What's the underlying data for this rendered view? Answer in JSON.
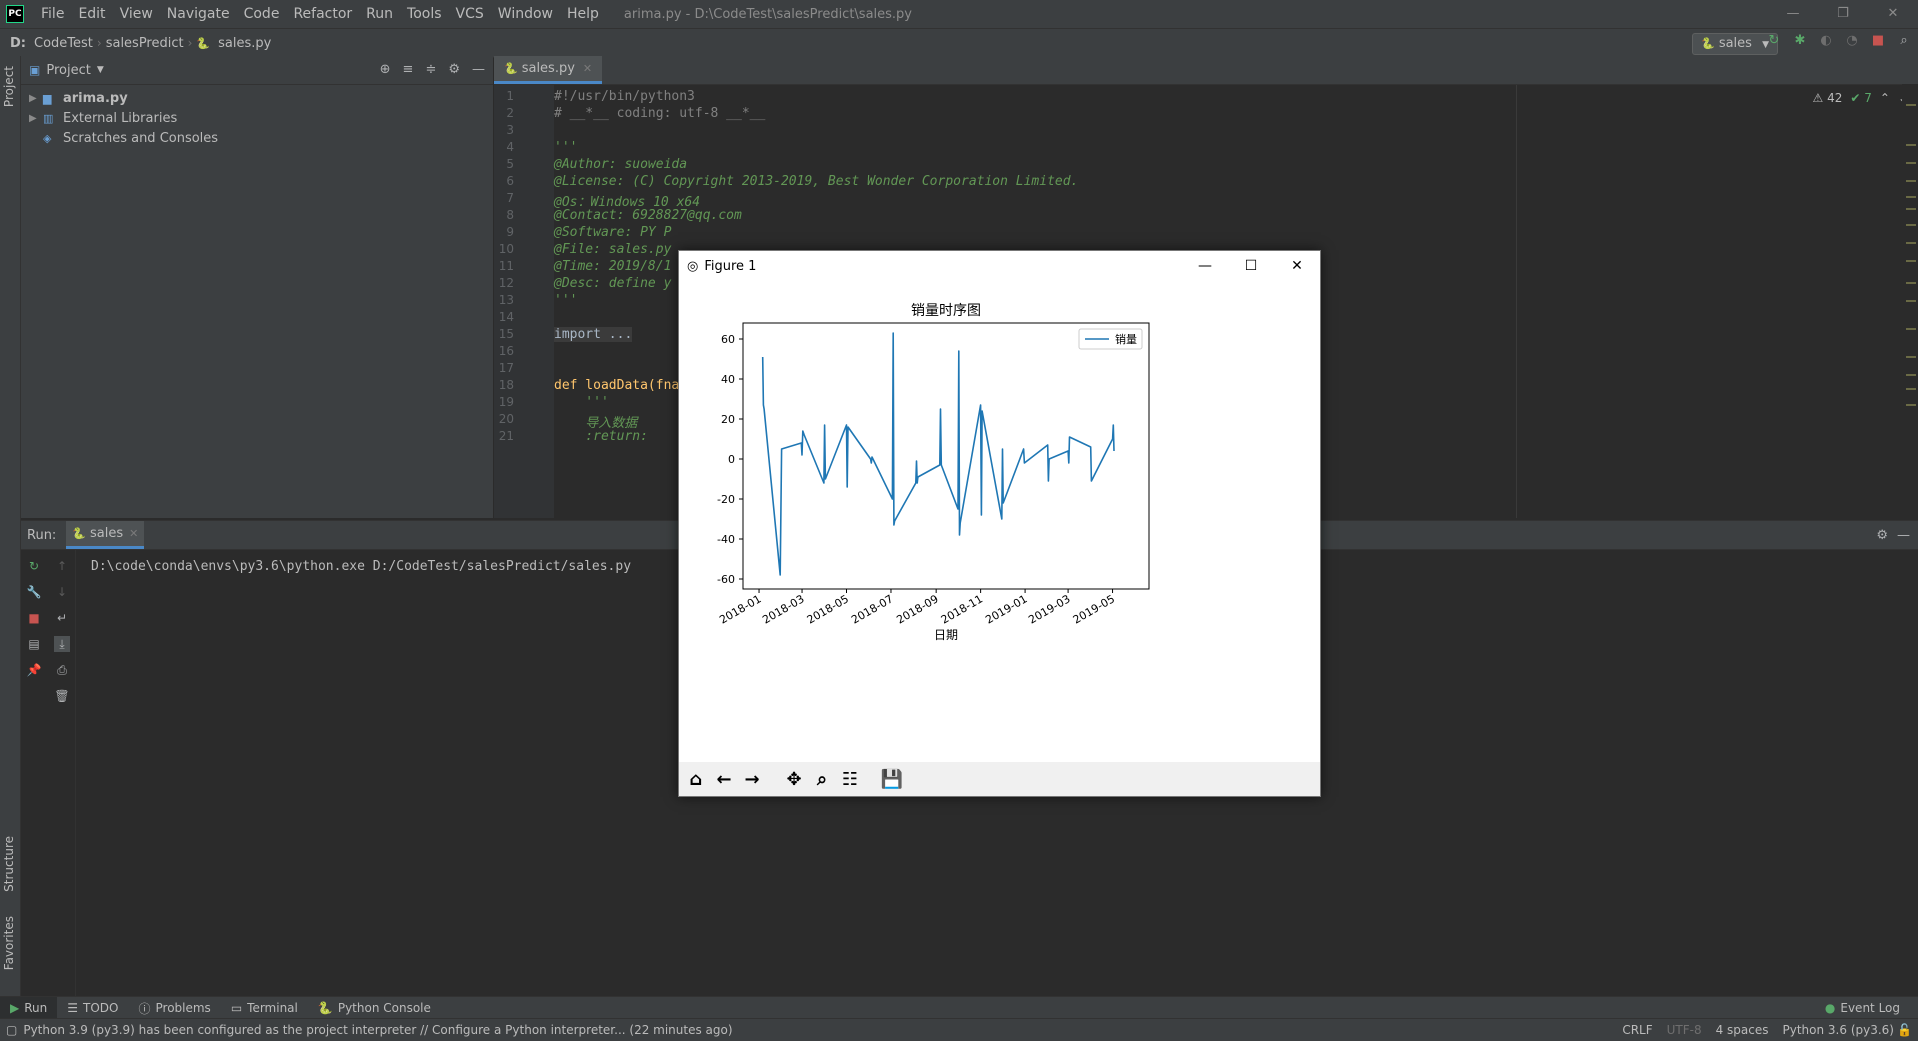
{
  "window": {
    "title": "arima.py - D:\\CodeTest\\salesPredict\\sales.py",
    "logo": "PC",
    "controls": [
      "—",
      "❐",
      "✕"
    ]
  },
  "menu": [
    "File",
    "Edit",
    "View",
    "Navigate",
    "Code",
    "Refactor",
    "Run",
    "Tools",
    "VCS",
    "Window",
    "Help"
  ],
  "breadcrumb": [
    "D:",
    "CodeTest",
    "salesPredict",
    "sales.py"
  ],
  "run_config": "sales",
  "project": {
    "header": "Project",
    "items": [
      {
        "label": "arima.py",
        "bold": true
      },
      {
        "label": "External Libraries",
        "bold": false
      },
      {
        "label": "Scratches and Consoles",
        "bold": false
      }
    ]
  },
  "side_tabs": {
    "project": "Project",
    "structure": "Structure",
    "favorites": "Favorites"
  },
  "editor": {
    "tab": "sales.py",
    "warnings": "⚠ 42",
    "checks": "✔ 7",
    "lines": [
      {
        "n": "1",
        "text": "#!/usr/bin/python3",
        "cls": "c-com"
      },
      {
        "n": "2",
        "text": "# __*__ coding: utf-8 __*__",
        "cls": "c-com"
      },
      {
        "n": "3",
        "text": "",
        "cls": ""
      },
      {
        "n": "4",
        "text": "'''",
        "cls": "c-doc"
      },
      {
        "n": "5",
        "text": "@Author: suoweida",
        "cls": "c-doc"
      },
      {
        "n": "6",
        "text": "@License: (C) Copyright 2013-2019, Best Wonder Corporation Limited.",
        "cls": "c-doc"
      },
      {
        "n": "7",
        "text": "@Os：Windows 10 x64",
        "cls": "c-doc"
      },
      {
        "n": "8",
        "text": "@Contact: 6928827@qq.com",
        "cls": "c-doc"
      },
      {
        "n": "9",
        "text": "@Software: PY P",
        "cls": "c-doc"
      },
      {
        "n": "10",
        "text": "@File: sales.py",
        "cls": "c-doc"
      },
      {
        "n": "11",
        "text": "@Time: 2019/8/1",
        "cls": "c-doc"
      },
      {
        "n": "12",
        "text": "@Desc: define y",
        "cls": "c-doc"
      },
      {
        "n": "13",
        "text": "'''",
        "cls": "c-doc"
      },
      {
        "n": "14",
        "text": "",
        "cls": ""
      },
      {
        "n": "15",
        "text": "import ...",
        "cls": "c-fold"
      },
      {
        "n": "16",
        "text": "",
        "cls": ""
      },
      {
        "n": "17",
        "text": "",
        "cls": ""
      },
      {
        "n": "18",
        "text": "def loadData(fna",
        "cls": "c-fn"
      },
      {
        "n": "19",
        "text": "    '''",
        "cls": "c-doc"
      },
      {
        "n": "20",
        "text": "    导入数据",
        "cls": "c-doc"
      },
      {
        "n": "21",
        "text": "    :return:",
        "cls": "c-doc"
      }
    ]
  },
  "run_panel": {
    "label": "Run:",
    "tab": "sales",
    "console": "D:\\code\\conda\\envs\\py3.6\\python.exe D:/CodeTest/salesPredict/sales.py"
  },
  "tool_windows": [
    "Run",
    "TODO",
    "Problems",
    "Terminal",
    "Python Console"
  ],
  "event_log": "Event Log",
  "status": {
    "message": "Python 3.9 (py3.9) has been configured as the project interpreter // Configure a Python interpreter... (22 minutes ago)",
    "line_sep": "CRLF",
    "encoding": "UTF-8",
    "indent": "4 spaces",
    "interpreter": "Python 3.6 (py3.6)"
  },
  "figure": {
    "title": "Figure 1",
    "controls": [
      "—",
      "☐",
      "✕"
    ]
  },
  "chart_data": {
    "type": "line",
    "title": "销量时序图",
    "xlabel": "日期",
    "ylabel": "",
    "legend": [
      "销量"
    ],
    "legend_position": "top-right",
    "color": "#1f77b4",
    "ylim": [
      -65,
      68
    ],
    "yticks": [
      -60,
      -40,
      -20,
      0,
      20,
      40,
      60
    ],
    "xticks": [
      "2018-01",
      "2018-03",
      "2018-05",
      "2018-07",
      "2018-09",
      "2018-11",
      "2019-01",
      "2019-03",
      "2019-05"
    ],
    "xlim": [
      "2017-12-10",
      "2019-06-20"
    ],
    "grid": false,
    "series": [
      {
        "name": "销量",
        "x": [
          "2018-01-06",
          "2018-01-07",
          "2018-01-08",
          "2018-01-30",
          "2018-02-01",
          "2018-02-28",
          "2018-03-01",
          "2018-03-02",
          "2018-03-04",
          "2018-03-31",
          "2018-04-01",
          "2018-04-02",
          "2018-05-01",
          "2018-05-02",
          "2018-05-03",
          "2018-06-03",
          "2018-06-04",
          "2018-06-05",
          "2018-07-03",
          "2018-07-04",
          "2018-07-05",
          "2018-07-06",
          "2018-08-04",
          "2018-08-05",
          "2018-08-06",
          "2018-08-07",
          "2018-09-06",
          "2018-09-07",
          "2018-09-08",
          "2018-10-01",
          "2018-10-02",
          "2018-10-03",
          "2018-10-04",
          "2018-11-01",
          "2018-11-02",
          "2018-11-03",
          "2018-11-30",
          "2018-12-01",
          "2018-12-02",
          "2018-12-30",
          "2018-12-31",
          "2019-02-01",
          "2019-02-02",
          "2019-02-03",
          "2019-03-01",
          "2019-03-02",
          "2019-03-03",
          "2019-04-01",
          "2019-04-02",
          "2019-05-01",
          "2019-05-02",
          "2019-05-03"
        ],
        "values": [
          51,
          27,
          25,
          -58,
          5,
          8,
          2,
          14,
          12,
          -12,
          17,
          -10,
          17,
          -14,
          16,
          0,
          -2,
          1,
          -20,
          63,
          -33,
          -31,
          -12,
          -1,
          -12,
          -9,
          -3,
          25,
          -3,
          -25,
          54,
          -38,
          -32,
          27,
          -28,
          24,
          -30,
          5,
          -22,
          5,
          -2,
          7,
          -11,
          0,
          4,
          -2,
          11,
          6,
          -11,
          10,
          17,
          4
        ]
      }
    ]
  }
}
